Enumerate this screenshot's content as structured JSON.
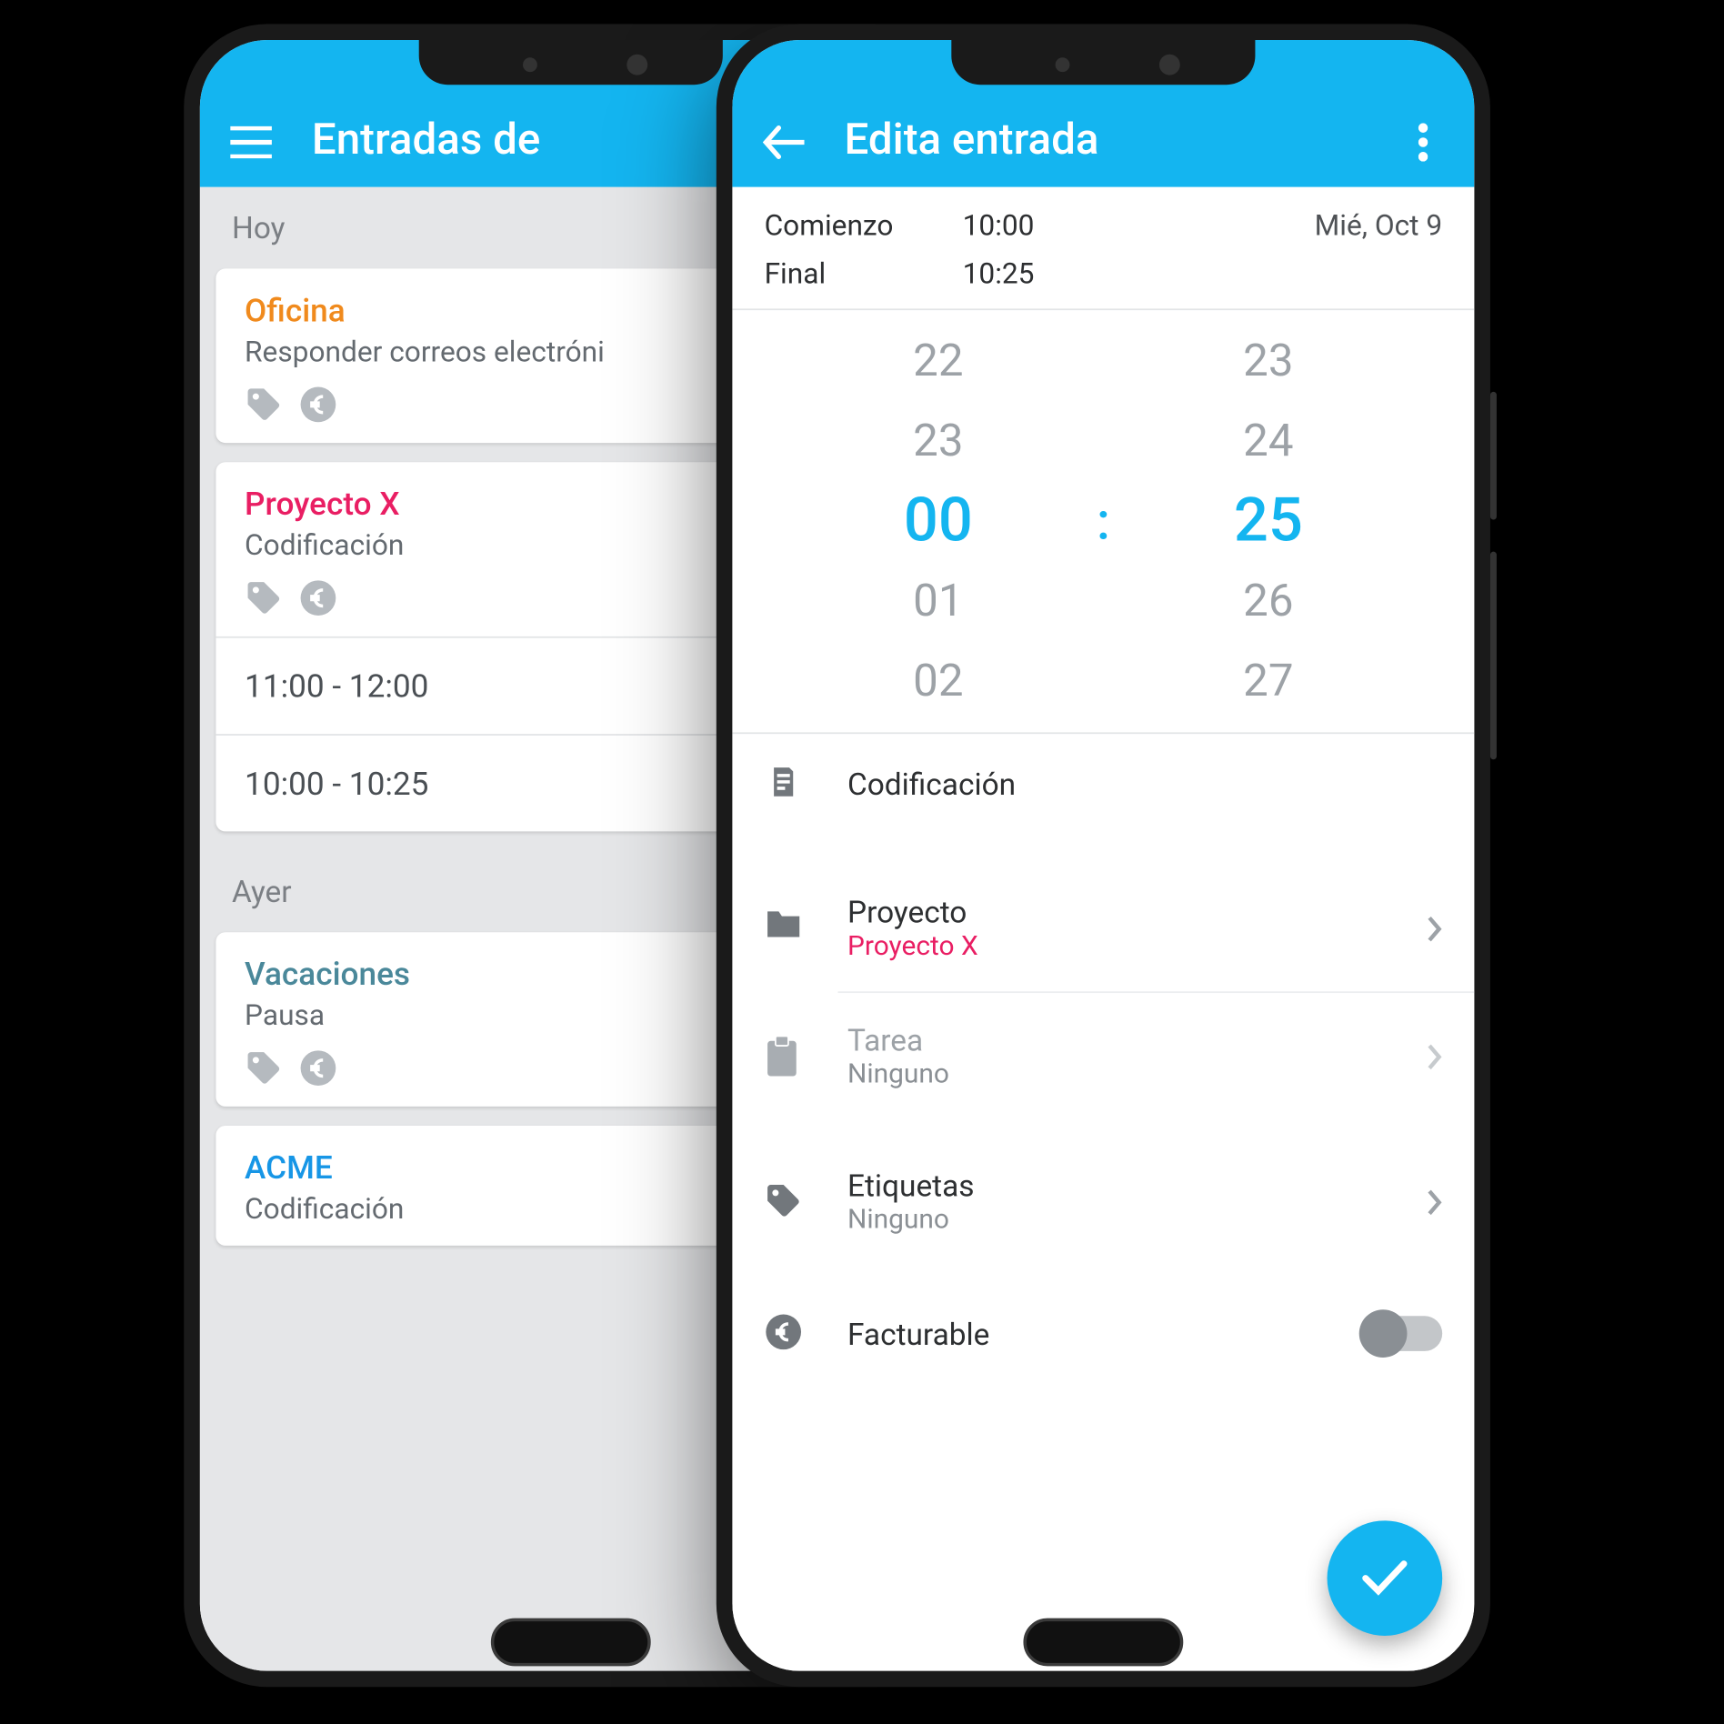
{
  "phone_left": {
    "appbar_title": "Entradas de",
    "sections": [
      {
        "header": "Hoy",
        "cards": [
          {
            "title": "Oficina",
            "title_color": "c-orange",
            "subtitle": "Responder correos electróni"
          },
          {
            "title": "Proyecto X",
            "title_color": "c-pink",
            "subtitle": "Codificación",
            "slots": [
              "11:00 - 12:00",
              "10:00 - 10:25"
            ]
          }
        ]
      },
      {
        "header": "Ayer",
        "cards": [
          {
            "title": "Vacaciones",
            "title_color": "c-teal",
            "subtitle": "Pausa"
          },
          {
            "title": "ACME",
            "title_color": "c-blue",
            "subtitle": "Codificación"
          }
        ]
      }
    ]
  },
  "phone_right": {
    "appbar_title": "Edita entrada",
    "start_label": "Comienzo",
    "end_label": "Final",
    "start_time": "10:00",
    "end_time": "10:25",
    "date": "Mié, Oct 9",
    "picker": {
      "hours": [
        "22",
        "23",
        "00",
        "01",
        "02"
      ],
      "minutes": [
        "23",
        "24",
        "25",
        "26",
        "27"
      ],
      "selected_hour": "00",
      "selected_minute": "25"
    },
    "description": "Codificación",
    "project_label": "Proyecto",
    "project_value": "Proyecto X",
    "task_label": "Tarea",
    "task_value": "Ninguno",
    "tags_label": "Etiquetas",
    "tags_value": "Ninguno",
    "billable_label": "Facturable"
  }
}
